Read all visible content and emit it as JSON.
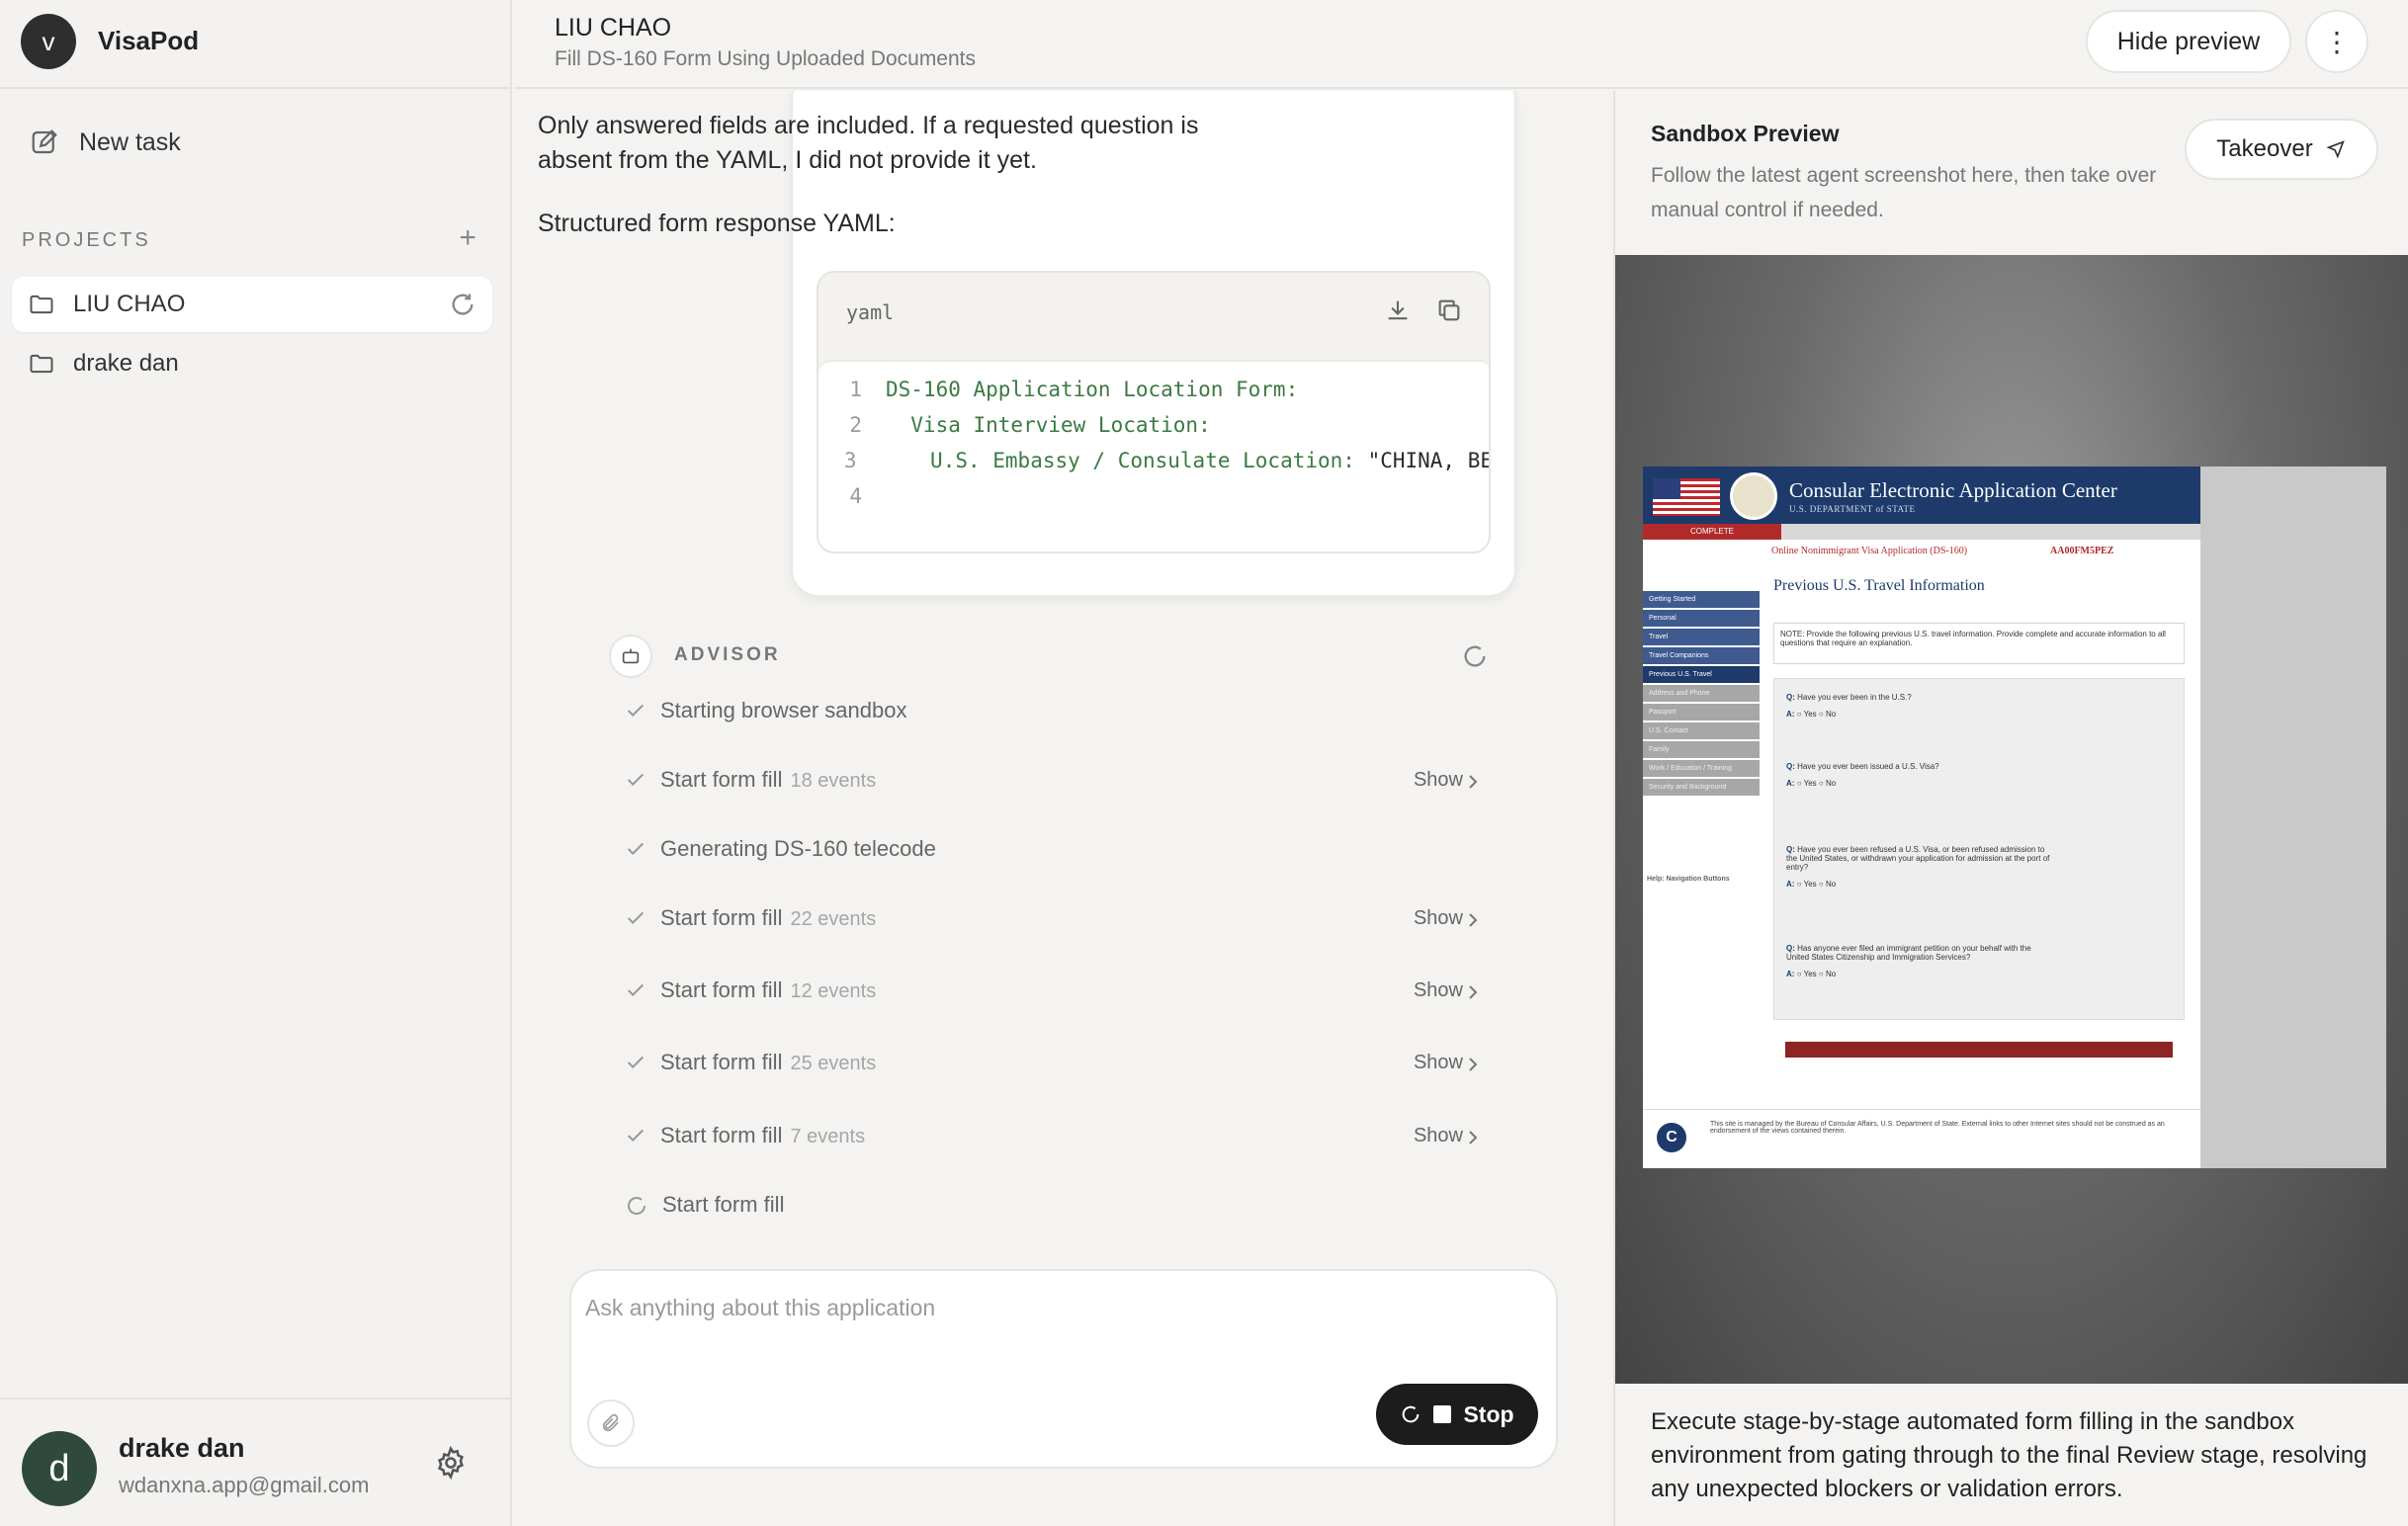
{
  "app": {
    "brand_initial": "v",
    "brand_name": "VisaPod"
  },
  "sidebar": {
    "new_task_label": "New task",
    "projects_label": "PROJECTS",
    "projects": [
      {
        "name": "LIU CHAO",
        "active": true
      },
      {
        "name": "drake dan",
        "active": false
      }
    ],
    "user": {
      "initial": "d",
      "name": "drake dan",
      "email": "wdanxna.app@gmail.com"
    }
  },
  "header": {
    "title": "LIU CHAO",
    "subtitle": "Fill DS-160 Form Using Uploaded Documents",
    "hide_preview_label": "Hide preview",
    "more_label": "⋮"
  },
  "message": {
    "paragraph1": "Only answered fields are included. If a requested question is absent from the YAML, I did not provide it yet.",
    "paragraph2": "Structured form response YAML:",
    "code": {
      "lang": "yaml",
      "lines": [
        {
          "n": "1",
          "text": "DS-160 Application Location Form:",
          "value": ""
        },
        {
          "n": "2",
          "text": "  Visa Interview Location:",
          "value": ""
        },
        {
          "n": "3",
          "text": "    U.S. Embassy / Consulate Location:",
          "value": " \"CHINA, BE"
        },
        {
          "n": "4",
          "text": "",
          "value": ""
        }
      ]
    }
  },
  "advisor": {
    "label": "ADVISOR",
    "steps": [
      {
        "label": "Starting browser sandbox",
        "events": "",
        "show": "",
        "state": "done"
      },
      {
        "label": "Start form fill",
        "events": "18 events",
        "show": "Show",
        "state": "done"
      },
      {
        "label": "Generating DS-160 telecode",
        "events": "",
        "show": "",
        "state": "done"
      },
      {
        "label": "Start form fill",
        "events": "22 events",
        "show": "Show",
        "state": "done"
      },
      {
        "label": "Start form fill",
        "events": "12 events",
        "show": "Show",
        "state": "done"
      },
      {
        "label": "Start form fill",
        "events": "25 events",
        "show": "Show",
        "state": "done"
      },
      {
        "label": "Start form fill",
        "events": "7 events",
        "show": "Show",
        "state": "done"
      },
      {
        "label": "Start form fill",
        "events": "",
        "show": "",
        "state": "running"
      }
    ]
  },
  "composer": {
    "placeholder": "Ask anything about this application",
    "stop_label": "Stop"
  },
  "preview": {
    "title": "Sandbox Preview",
    "description": "Follow the latest agent screenshot here, then take over manual control if needed.",
    "takeover_label": "Takeover",
    "footer": "Execute stage-by-stage automated form filling in the sandbox environment from gating through to the final Review stage, resolving any unexpected blockers or validation errors.",
    "screenshot": {
      "site_title": "Consular Electronic Application Center",
      "site_sub": "U.S. DEPARTMENT of STATE",
      "tab_complete": "COMPLETE",
      "app_line": "Online Nonimmigrant Visa Application (DS-160)",
      "app_id": "AA00FM5PEZ",
      "page_heading": "Previous U.S. Travel Information",
      "note": "NOTE: Provide the following previous U.S. travel information. Provide complete and accurate information to all questions that require an explanation.",
      "nav": [
        {
          "label": "Getting Started",
          "state": "done"
        },
        {
          "label": "Personal",
          "state": "done"
        },
        {
          "label": "Travel",
          "state": "done"
        },
        {
          "label": "Travel Companions",
          "state": "done"
        },
        {
          "label": "Previous U.S. Travel",
          "state": "cur"
        },
        {
          "label": "Address and Phone",
          "state": "todo"
        },
        {
          "label": "Passport",
          "state": "todo"
        },
        {
          "label": "U.S. Contact",
          "state": "todo"
        },
        {
          "label": "Family",
          "state": "todo"
        },
        {
          "label": "Work / Education / Training",
          "state": "todo"
        },
        {
          "label": "Security and Background",
          "state": "todo"
        }
      ],
      "questions": [
        "Have you ever been in the U.S.?",
        "Have you ever been issued a U.S. Visa?",
        "Have you ever been refused a U.S. Visa, or been refused admission to the United States, or withdrawn your application for admission at the port of entry?",
        "Has anyone ever filed an immigrant petition on your behalf with the United States Citizenship and Immigration Services?"
      ],
      "help_title": "Help: Navigation Buttons",
      "footer_text": "This site is managed by the Bureau of Consular Affairs, U.S. Department of State. External links to other Internet sites should not be construed as an endorsement of the views contained therein."
    }
  }
}
